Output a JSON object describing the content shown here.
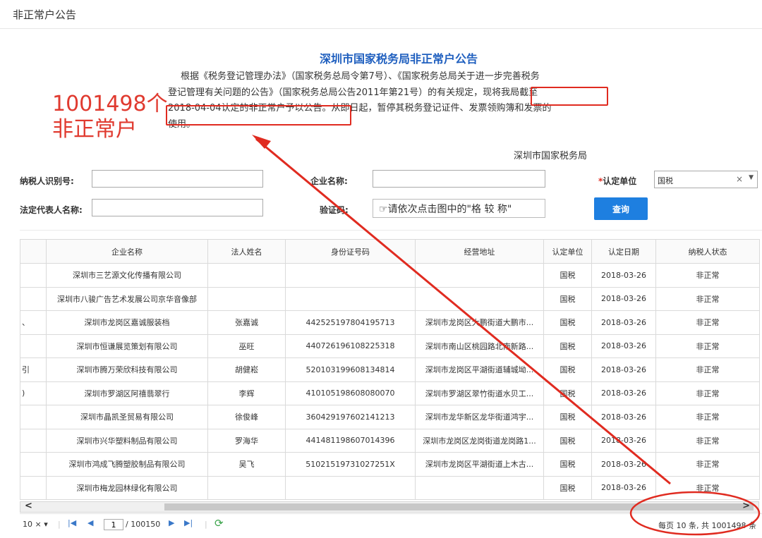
{
  "page_title": "非正常户公告",
  "notice": {
    "title": "深圳市国家税务局非正常户公告",
    "lines": [
      "根据《税务登记管理办法》（国家税务总局令第7号）、《国家税务总局关于进一步完善税务",
      "登记管理有关问题的公告》（国家税务总局公告2011年第21号）的有关规定，现将我局截至",
      "2018-04-04认定的非正常户予以公告。从即日起，暂停其税务登记证件、发票领购簿和发票的",
      "使用。"
    ],
    "signature": "深圳市国家税务局"
  },
  "annotation": {
    "line1": "1001498个",
    "line2": "非正常户"
  },
  "search": {
    "taxpayer_id_label": "纳税人识别号:",
    "company_name_label": "企业名称:",
    "unit_label": "认定单位",
    "unit_value": "国税",
    "legal_rep_label": "法定代表人名称:",
    "captcha_label": "验证码:",
    "captcha_prompt": "请依次点击图中的\"格 较 称\"",
    "query_button": "查询"
  },
  "table": {
    "headers": [
      "",
      "企业名称",
      "法人姓名",
      "身份证号码",
      "经营地址",
      "认定单位",
      "认定日期",
      "纳税人状态"
    ],
    "rows": [
      [
        "",
        "深圳市三艺源文化传播有限公司",
        "",
        "",
        "",
        "国税",
        "2018-03-26",
        "非正常"
      ],
      [
        "",
        "深圳市八骏广告艺术发展公司京华音像部",
        "",
        "",
        "",
        "国税",
        "2018-03-26",
        "非正常"
      ],
      [
        "、",
        "深圳市龙岗区嘉诚服装档",
        "张嘉诚",
        "442525197804195713",
        "深圳市龙岗区大鹏街道大鹏市...",
        "国税",
        "2018-03-26",
        "非正常"
      ],
      [
        "",
        "深圳市恒谦展览策划有限公司",
        "巫旺",
        "440726196108225318",
        "深圳市南山区桃园路北南新路...",
        "国税",
        "2018-03-26",
        "非正常"
      ],
      [
        "引",
        "深圳市腾万荣欣科技有限公司",
        "胡健崧",
        "520103199608134814",
        "深圳市龙岗区平湖街道辅城坳...",
        "国税",
        "2018-03-26",
        "非正常"
      ],
      [
        ")",
        "深圳市罗湖区阿禧翡翠行",
        "李辉",
        "410105198608080070",
        "深圳市罗湖区翠竹街道水贝工...",
        "国税",
        "2018-03-26",
        "非正常"
      ],
      [
        "",
        "深圳市晶凯圣贸易有限公司",
        "徐俊峰",
        "360429197602141213",
        "深圳市龙华新区龙华街道鸿宇...",
        "国税",
        "2018-03-26",
        "非正常"
      ],
      [
        "",
        "深圳市兴华塑料制品有限公司",
        "罗海华",
        "441481198607014396",
        "深圳市龙岗区龙岗街道龙岗路1...",
        "国税",
        "2018-03-26",
        "非正常"
      ],
      [
        "",
        "深圳市鸿成飞腾塑胶制品有限公司",
        "吴飞",
        "51021519731027251X",
        "深圳市龙岗区平湖街道上木古...",
        "国税",
        "2018-03-26",
        "非正常"
      ],
      [
        "",
        "深圳市梅龙园林绿化有限公司",
        "",
        "",
        "",
        "国税",
        "2018-03-26",
        "非正常"
      ]
    ]
  },
  "pager": {
    "page_size": "10 ×",
    "current_page": "1",
    "total_pages": "/ 100150",
    "info": "每页 10 条, 共 1001498 条"
  },
  "colors": {
    "accent": "#1e7fe0",
    "annotation": "#e02b20",
    "title": "#1f5fbf"
  }
}
